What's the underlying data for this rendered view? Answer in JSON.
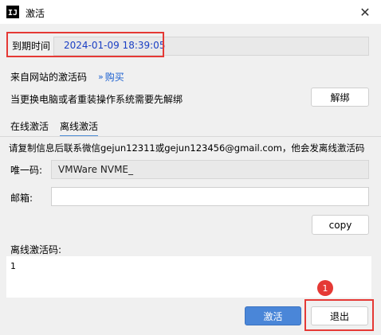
{
  "window": {
    "app_icon_text": "IJ",
    "title": "激活",
    "close_glyph": "✕"
  },
  "expiry": {
    "label": "到期时间",
    "value": "2024-01-09 18:39:05"
  },
  "source": {
    "label": "来自网站的激活码",
    "buy_chevron": "»",
    "buy_label": "购买"
  },
  "unbind": {
    "hint": "当更换电脑或者重装操作系统需要先解绑",
    "button": "解绑"
  },
  "tabs": [
    {
      "label": "在线激活",
      "active": false
    },
    {
      "label": "离线激活",
      "active": true
    }
  ],
  "offline": {
    "instruction": "请复制信息后联系微信gejun12311或gejun123456@gmail.com，他会发离线激活码",
    "unique_label": "唯一码:",
    "unique_value": "VMWare NVME_",
    "email_label": "邮箱:",
    "email_value": "",
    "copy_button": "copy",
    "code_label": "离线激活码:",
    "code_value": "1"
  },
  "footer": {
    "activate_button": "激活",
    "exit_button": "退出",
    "badge_number": "1"
  },
  "colors": {
    "highlight": "#e53935",
    "accent": "#4a86d8",
    "link": "#1a5fd0",
    "date": "#1a3fc4"
  },
  "icons": {
    "app": "app-icon",
    "close": "close-icon",
    "buy": "double-chevron-icon"
  }
}
